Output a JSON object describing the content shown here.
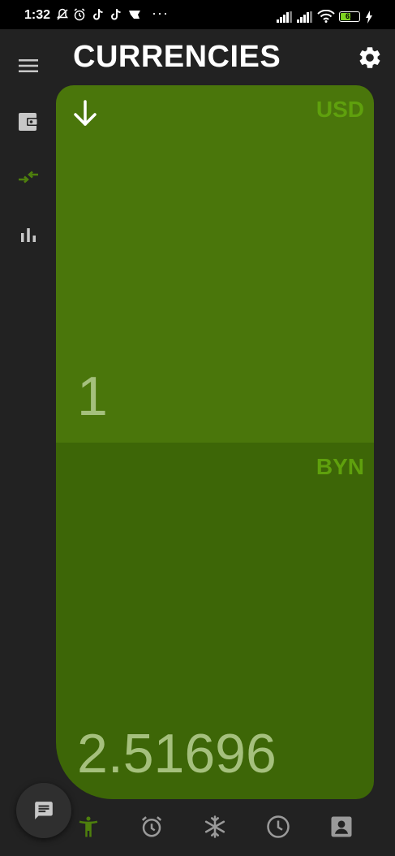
{
  "status_bar": {
    "time": "1:32",
    "dots": "···",
    "battery_level": "61"
  },
  "header": {
    "title": "CURRENCIES"
  },
  "rail": {
    "items": [
      {
        "icon": "menu-icon",
        "active": false
      },
      {
        "icon": "wallet-icon",
        "active": false
      },
      {
        "icon": "swap-arrows-icon",
        "active": true
      },
      {
        "icon": "bar-chart-icon",
        "active": false
      }
    ]
  },
  "converter": {
    "from": {
      "code": "USD",
      "amount": "1"
    },
    "to": {
      "code": "BYN",
      "amount": "2.51696"
    }
  },
  "bottom_nav": {
    "items": [
      {
        "icon": "accessibility-icon",
        "active": true
      },
      {
        "icon": "alarm-icon",
        "active": false
      },
      {
        "icon": "snowflake-icon",
        "active": false
      },
      {
        "icon": "clock-icon",
        "active": false
      },
      {
        "icon": "contact-card-icon",
        "active": false
      }
    ]
  },
  "colors": {
    "accent": "#4e7f0d",
    "panel_top": "#4a760b",
    "panel_bottom": "#3d6607",
    "code_text": "#5fa00d",
    "amount_text": "#a5c07d",
    "background": "#222222"
  }
}
